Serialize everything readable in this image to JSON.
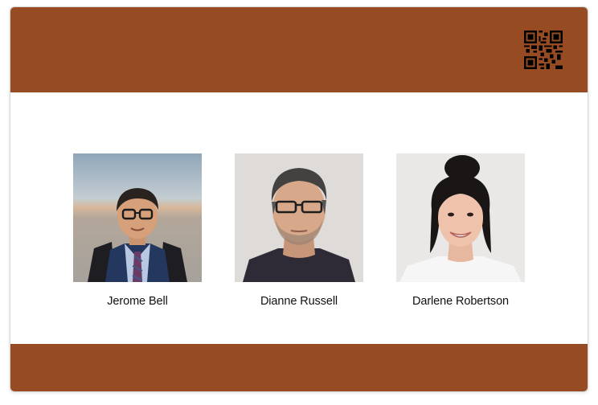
{
  "colors": {
    "band": "#964B22",
    "background": "#ffffff",
    "text": "#111111"
  },
  "header": {
    "qr_icon": "qr-code-icon"
  },
  "people": [
    {
      "name": "Jerome Bell",
      "photo": "child-portrait-glasses-tie"
    },
    {
      "name": "Dianne Russell",
      "photo": "man-portrait-glasses-stubble"
    },
    {
      "name": "Darlene Robertson",
      "photo": "woman-portrait-smiling-bun"
    }
  ]
}
